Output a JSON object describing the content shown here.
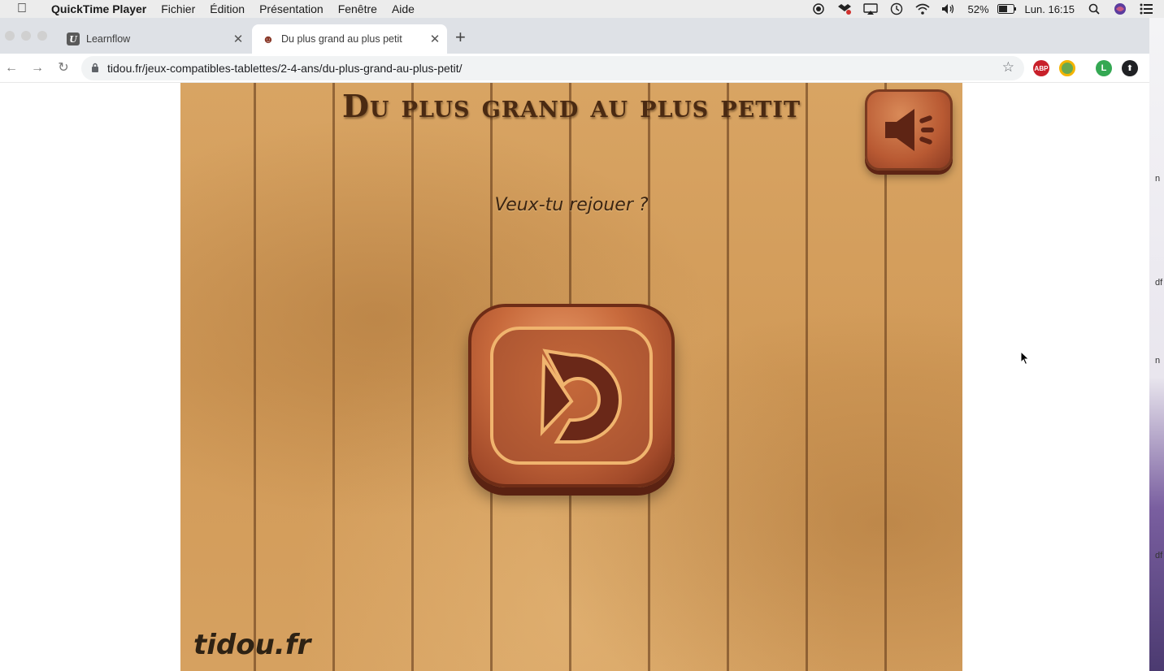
{
  "menubar": {
    "app_name": "QuickTime Player",
    "items": [
      "Fichier",
      "Édition",
      "Présentation",
      "Fenêtre",
      "Aide"
    ],
    "battery": "52%",
    "clock": "Lun. 16:15"
  },
  "browser": {
    "tabs": [
      {
        "title": "Learnflow",
        "favicon": "U"
      },
      {
        "title": "Du plus grand au plus petit",
        "favicon": "☻"
      }
    ],
    "url": "tidou.fr/jeux-compatibles-tablettes/2-4-ans/du-plus-grand-au-plus-petit/",
    "extensions": [
      {
        "name": "adblock-icon",
        "label": "ABP",
        "color": "#c8202a"
      },
      {
        "name": "extension-globe-icon",
        "label": "",
        "color": "#6aa84f"
      },
      {
        "name": "profile-avatar",
        "label": "L",
        "color": "#34a853"
      },
      {
        "name": "update-icon",
        "label": "⬆",
        "color": "#202124"
      }
    ]
  },
  "game": {
    "title": "Du plus grand au plus petit",
    "replay_prompt": "Veux-tu rejouer ?",
    "brand": "tidou.fr",
    "colors": {
      "wood": "#d19a58",
      "button": "#c86a3c",
      "title": "#4a2a12"
    }
  },
  "desktop_labels": [
    "n",
    "df",
    "n",
    "df"
  ]
}
